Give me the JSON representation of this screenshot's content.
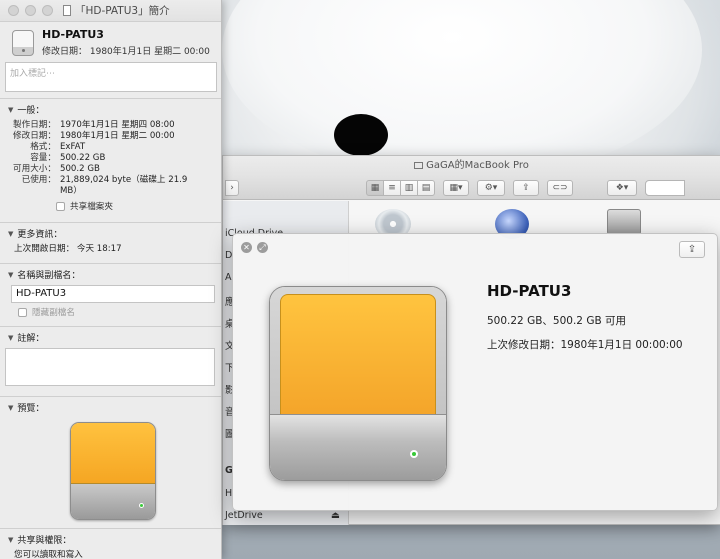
{
  "info_window": {
    "title": "「HD-PATU3」簡介",
    "disk_name": "HD-PATU3",
    "modified_summary": "修改日期：  1980年1月1日 星期二 00:00",
    "tags_placeholder": "加入標記⋯",
    "general": {
      "header": "一般：",
      "rows": [
        {
          "label": "製作日期：",
          "value": "1970年1月1日 星期四 08:00"
        },
        {
          "label": "修改日期：",
          "value": "1980年1月1日 星期二 00:00"
        },
        {
          "label": "格式：",
          "value": "ExFAT"
        },
        {
          "label": "容量：",
          "value": "500.22 GB"
        },
        {
          "label": "可用大小：",
          "value": "500.2 GB"
        },
        {
          "label": "已使用：",
          "value": "21,889,024 byte（磁碟上 21.9 MB）"
        }
      ],
      "shared_folder_label": "共享檔案夾"
    },
    "more_info": {
      "header": "更多資訊：",
      "last_opened": "上次開啟日期：  今天 18:17"
    },
    "name_ext": {
      "header": "名稱與副檔名：",
      "name_value": "HD-PATU3",
      "hide_ext_label": "隱藏副檔名"
    },
    "comments": {
      "header": "註解："
    },
    "preview": {
      "header": "預覽："
    },
    "sharing": {
      "header": "共享與權限：",
      "status": "您可以讀取和寫入"
    }
  },
  "finder": {
    "title": "GaGA的MacBook Pro",
    "sidebar": [
      "iCloud Drive",
      "D",
      "A",
      "應",
      "桌",
      "文",
      "下",
      "影",
      "音",
      "圖",
      "G",
      "H",
      "JetDrive"
    ],
    "eject_symbol": "⏏"
  },
  "quicklook": {
    "name": "HD-PATU3",
    "size": "500.22 GB、500.2 GB 可用",
    "modified": "上次修改日期：1980年1月1日 00:00:00",
    "share_symbol": "⇪"
  },
  "colors": {
    "drive_orange": "#f5a623",
    "led_green": "#3cc93c"
  }
}
